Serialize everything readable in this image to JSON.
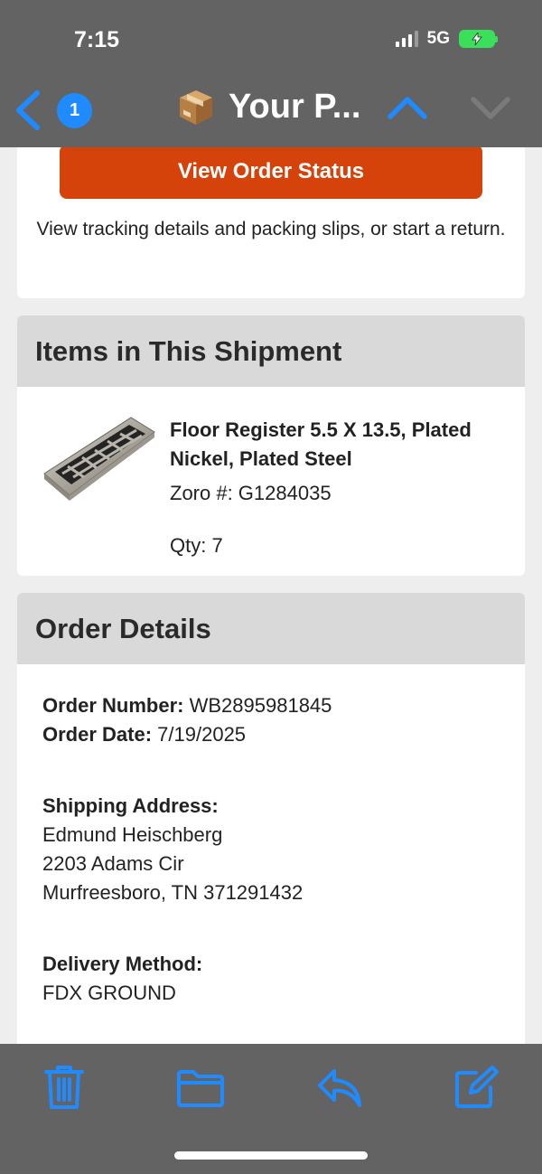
{
  "status_bar": {
    "time": "7:15",
    "network": "5G"
  },
  "nav": {
    "badge_count": "1",
    "title": "Your P...",
    "title_icon": "package-icon",
    "accent_color": "#1f8bff"
  },
  "order_status": {
    "button_label": "View Order Status",
    "description": "View tracking details and packing slips, or start a return.",
    "button_color": "#d5430b"
  },
  "shipment": {
    "heading": "Items in This Shipment",
    "items": [
      {
        "title": "Floor Register 5.5 X 13.5, Plated Nickel, Plated Steel",
        "sku_label": "Zoro #: G1284035",
        "qty_label": "Qty: 7",
        "image": "floor-register-image"
      }
    ]
  },
  "order_details": {
    "heading": "Order Details",
    "order_number_label": "Order Number:",
    "order_number": "WB2895981845",
    "order_date_label": "Order Date:",
    "order_date": "7/19/2025",
    "shipping_label": "Shipping Address:",
    "shipping_name": "Edmund Heischberg",
    "shipping_street": "2203 Adams Cir",
    "shipping_city": "Murfreesboro, TN 371291432",
    "delivery_label": "Delivery Method:",
    "delivery_method": "FDX GROUND"
  },
  "toolbar": {
    "icons": [
      "trash-icon",
      "folder-icon",
      "reply-icon",
      "compose-icon"
    ]
  }
}
